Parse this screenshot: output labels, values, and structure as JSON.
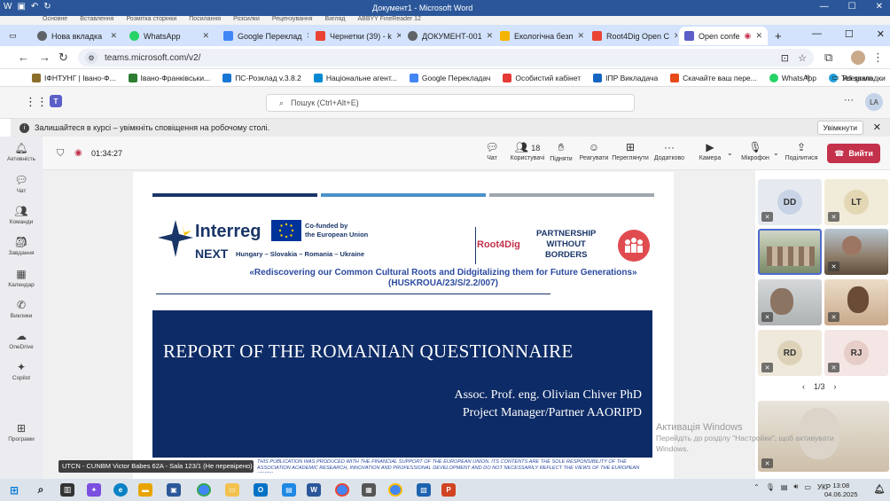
{
  "word": {
    "title": "Документ1 - Microsoft Word",
    "ribbon_tabs": [
      "Основне",
      "Вставлення",
      "Розмітка сторінки",
      "Посилання",
      "Розсилки",
      "Рецензування",
      "Вигляд",
      "ABBYY FineReader 12"
    ]
  },
  "browser": {
    "tabs": [
      {
        "label": "Нова вкладка",
        "color": "#5f6368"
      },
      {
        "label": "WhatsApp",
        "color": "#25d366"
      },
      {
        "label": "Google Переклад",
        "color": "#4285f4"
      },
      {
        "label": "Чернетки (39) - k",
        "color": "#ea4335"
      },
      {
        "label": "ДОКУМЕНТ-001",
        "color": "#5f6368"
      },
      {
        "label": "Екологічна безп",
        "color": "#f4b400"
      },
      {
        "label": "Root4Dig Open C",
        "color": "#ea4335"
      },
      {
        "label": "Open confe",
        "color": "#5b5fc7"
      }
    ],
    "new_tab": "+",
    "url": "teams.microsoft.com/v2/",
    "bookmarks": [
      {
        "label": "ІФНТУНГ | Івано-Ф...",
        "color": "#8b6d2a"
      },
      {
        "label": "Івано-Франківськи...",
        "color": "#2e7d32"
      },
      {
        "label": "ПС-Розклад v.3.8.2",
        "color": "#1976d2"
      },
      {
        "label": "Національне агент...",
        "color": "#0288d1"
      },
      {
        "label": "Google Перекладач",
        "color": "#4285f4"
      },
      {
        "label": "Особистий кабінет",
        "color": "#e53935"
      },
      {
        "label": "IПР Викладача",
        "color": "#1565c0"
      },
      {
        "label": "Скачайте ваш пере...",
        "color": "#e64a19"
      },
      {
        "label": "WhatsApp",
        "color": "#25d366"
      },
      {
        "label": "Telegram",
        "color": "#229ed9"
      }
    ],
    "all_bookmarks": "Усі закладки"
  },
  "teams": {
    "search_placeholder": "Пошук (Ctrl+Alt+E)",
    "avatar": "LA",
    "notification": "Залишайтеся в курсі – увімкніть сповіщення на робочому столі.",
    "notification_button": "Увімкнути",
    "rail": [
      "Активність",
      "Чат",
      "Команди",
      "Завдання",
      "Календар",
      "Виклики",
      "OneDrive",
      "Copilot",
      "Програми"
    ],
    "timer": "01:34:27",
    "participants_count": "18",
    "tools": [
      "Чат",
      "Користувачі",
      "Підняти",
      "Реагувати",
      "Переглянути",
      "Додатково",
      "Камера",
      "Мікрофон",
      "Поділитися"
    ],
    "leave": "Вийти"
  },
  "slide": {
    "interreg": "Interreg",
    "next": "NEXT",
    "countries": "Hungary – Slovakia – Romania – Ukraine",
    "cofunded": "Co-funded by\nthe European Union",
    "root4dig": "Root4Dig",
    "partnership": "PARTNERSHIP\nWITHOUT\nBORDERS",
    "subtitle": "«Rediscovering our Common Cultural Roots and Didgitalizing them for Future Generations» (HUSKROUA/23/S/2.2/007)",
    "title": "REPORT OF THE ROMANIAN QUESTIONNAIRE",
    "author": "Assoc. Prof. eng. Olivian Chiver PhD",
    "role": "Project Manager/Partner AAORIPD",
    "disclaimer": "THIS PUBLICATION WAS PRODUCED WITH THE FINANCIAL SUPPORT OF THE EUROPEAN UNION. ITS CONTENTS ARE THE SOLE RESPONSIBILITY OF THE ASSOCIATION ACADEMIC RESEARCH, INNOVATION AND PROFESSIONAL DEVELOPMENT AND DO NOT NECESSARILY REFLECT THE VIEWS OF THE EUROPEAN UNION",
    "bar_colors": [
      "#1a3668",
      "#4a90c8",
      "#9ea7ad"
    ]
  },
  "presenter_label": "UTCN - CUNBM Victor Babes 62A - Sala 123/1 (Не перевірено)",
  "participants": {
    "initials": [
      "DD",
      "LT",
      "RD",
      "RJ"
    ],
    "pager": "1/3"
  },
  "watermark": {
    "title": "Активація Windows",
    "line1": "Перейдіть до розділу \"Настройки\", щоб активувати",
    "line2": "Windows."
  },
  "taskbar": {
    "lang": "УКР",
    "time": "13:08",
    "date": "04.06.2025"
  }
}
